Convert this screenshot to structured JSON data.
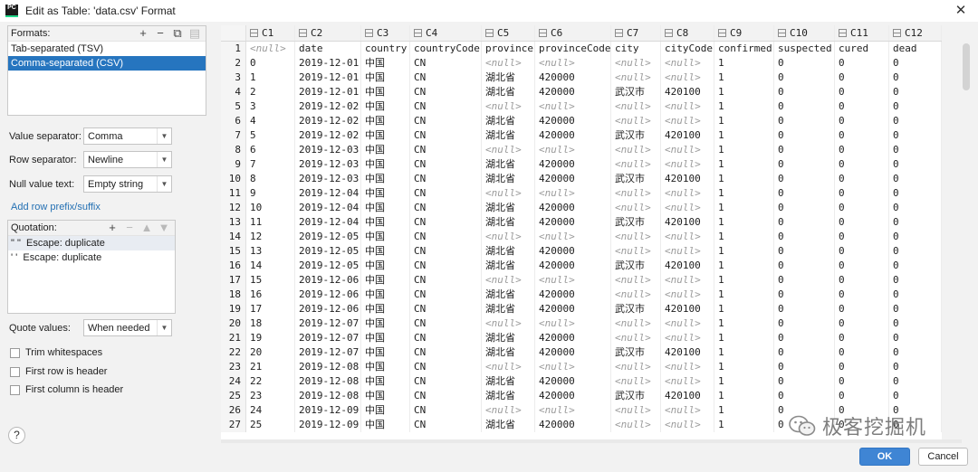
{
  "window": {
    "title": "Edit as Table: 'data.csv' Format",
    "app_logo_text": "PC"
  },
  "formats": {
    "label": "Formats:",
    "items": [
      "Tab-separated (TSV)",
      "Comma-separated (CSV)"
    ],
    "selected_index": 1
  },
  "settings": {
    "value_separator": {
      "label": "Value separator:",
      "value": "Comma"
    },
    "row_separator": {
      "label": "Row separator:",
      "value": "Newline"
    },
    "null_value_text": {
      "label": "Null value text:",
      "value": "Empty string"
    },
    "add_prefix_link": "Add row prefix/suffix"
  },
  "quotation": {
    "label": "Quotation:",
    "items": [
      {
        "quote": "\" \"",
        "text": "Escape: duplicate"
      },
      {
        "quote": "' '",
        "text": "Escape: duplicate"
      }
    ]
  },
  "quote_values": {
    "label": "Quote values:",
    "value": "When needed"
  },
  "checkboxes": [
    {
      "label": "Trim whitespaces",
      "checked": false
    },
    {
      "label": "First row is header",
      "checked": false
    },
    {
      "label": "First column is header",
      "checked": false
    }
  ],
  "buttons": {
    "ok": "OK",
    "cancel": "Cancel",
    "help": "?"
  },
  "watermark": "极客挖掘机",
  "table": {
    "columns": [
      "C1",
      "C2",
      "C3",
      "C4",
      "C5",
      "C6",
      "C7",
      "C8",
      "C9",
      "C10",
      "C11",
      "C12"
    ],
    "null_text": "<null>",
    "rows": [
      [
        null,
        "date",
        "country",
        "countryCode",
        "province",
        "provinceCode",
        "city",
        "cityCode",
        "confirmed",
        "suspected",
        "cured",
        "dead"
      ],
      [
        "0",
        "2019-12-01",
        "中国",
        "CN",
        null,
        null,
        null,
        null,
        "1",
        "0",
        "0",
        "0"
      ],
      [
        "1",
        "2019-12-01",
        "中国",
        "CN",
        "湖北省",
        "420000",
        null,
        null,
        "1",
        "0",
        "0",
        "0"
      ],
      [
        "2",
        "2019-12-01",
        "中国",
        "CN",
        "湖北省",
        "420000",
        "武汉市",
        "420100",
        "1",
        "0",
        "0",
        "0"
      ],
      [
        "3",
        "2019-12-02",
        "中国",
        "CN",
        null,
        null,
        null,
        null,
        "1",
        "0",
        "0",
        "0"
      ],
      [
        "4",
        "2019-12-02",
        "中国",
        "CN",
        "湖北省",
        "420000",
        null,
        null,
        "1",
        "0",
        "0",
        "0"
      ],
      [
        "5",
        "2019-12-02",
        "中国",
        "CN",
        "湖北省",
        "420000",
        "武汉市",
        "420100",
        "1",
        "0",
        "0",
        "0"
      ],
      [
        "6",
        "2019-12-03",
        "中国",
        "CN",
        null,
        null,
        null,
        null,
        "1",
        "0",
        "0",
        "0"
      ],
      [
        "7",
        "2019-12-03",
        "中国",
        "CN",
        "湖北省",
        "420000",
        null,
        null,
        "1",
        "0",
        "0",
        "0"
      ],
      [
        "8",
        "2019-12-03",
        "中国",
        "CN",
        "湖北省",
        "420000",
        "武汉市",
        "420100",
        "1",
        "0",
        "0",
        "0"
      ],
      [
        "9",
        "2019-12-04",
        "中国",
        "CN",
        null,
        null,
        null,
        null,
        "1",
        "0",
        "0",
        "0"
      ],
      [
        "10",
        "2019-12-04",
        "中国",
        "CN",
        "湖北省",
        "420000",
        null,
        null,
        "1",
        "0",
        "0",
        "0"
      ],
      [
        "11",
        "2019-12-04",
        "中国",
        "CN",
        "湖北省",
        "420000",
        "武汉市",
        "420100",
        "1",
        "0",
        "0",
        "0"
      ],
      [
        "12",
        "2019-12-05",
        "中国",
        "CN",
        null,
        null,
        null,
        null,
        "1",
        "0",
        "0",
        "0"
      ],
      [
        "13",
        "2019-12-05",
        "中国",
        "CN",
        "湖北省",
        "420000",
        null,
        null,
        "1",
        "0",
        "0",
        "0"
      ],
      [
        "14",
        "2019-12-05",
        "中国",
        "CN",
        "湖北省",
        "420000",
        "武汉市",
        "420100",
        "1",
        "0",
        "0",
        "0"
      ],
      [
        "15",
        "2019-12-06",
        "中国",
        "CN",
        null,
        null,
        null,
        null,
        "1",
        "0",
        "0",
        "0"
      ],
      [
        "16",
        "2019-12-06",
        "中国",
        "CN",
        "湖北省",
        "420000",
        null,
        null,
        "1",
        "0",
        "0",
        "0"
      ],
      [
        "17",
        "2019-12-06",
        "中国",
        "CN",
        "湖北省",
        "420000",
        "武汉市",
        "420100",
        "1",
        "0",
        "0",
        "0"
      ],
      [
        "18",
        "2019-12-07",
        "中国",
        "CN",
        null,
        null,
        null,
        null,
        "1",
        "0",
        "0",
        "0"
      ],
      [
        "19",
        "2019-12-07",
        "中国",
        "CN",
        "湖北省",
        "420000",
        null,
        null,
        "1",
        "0",
        "0",
        "0"
      ],
      [
        "20",
        "2019-12-07",
        "中国",
        "CN",
        "湖北省",
        "420000",
        "武汉市",
        "420100",
        "1",
        "0",
        "0",
        "0"
      ],
      [
        "21",
        "2019-12-08",
        "中国",
        "CN",
        null,
        null,
        null,
        null,
        "1",
        "0",
        "0",
        "0"
      ],
      [
        "22",
        "2019-12-08",
        "中国",
        "CN",
        "湖北省",
        "420000",
        null,
        null,
        "1",
        "0",
        "0",
        "0"
      ],
      [
        "23",
        "2019-12-08",
        "中国",
        "CN",
        "湖北省",
        "420000",
        "武汉市",
        "420100",
        "1",
        "0",
        "0",
        "0"
      ],
      [
        "24",
        "2019-12-09",
        "中国",
        "CN",
        null,
        null,
        null,
        null,
        "1",
        "0",
        "0",
        "0"
      ],
      [
        "25",
        "2019-12-09",
        "中国",
        "CN",
        "湖北省",
        "420000",
        null,
        null,
        "1",
        "0",
        "0",
        "0"
      ]
    ]
  }
}
